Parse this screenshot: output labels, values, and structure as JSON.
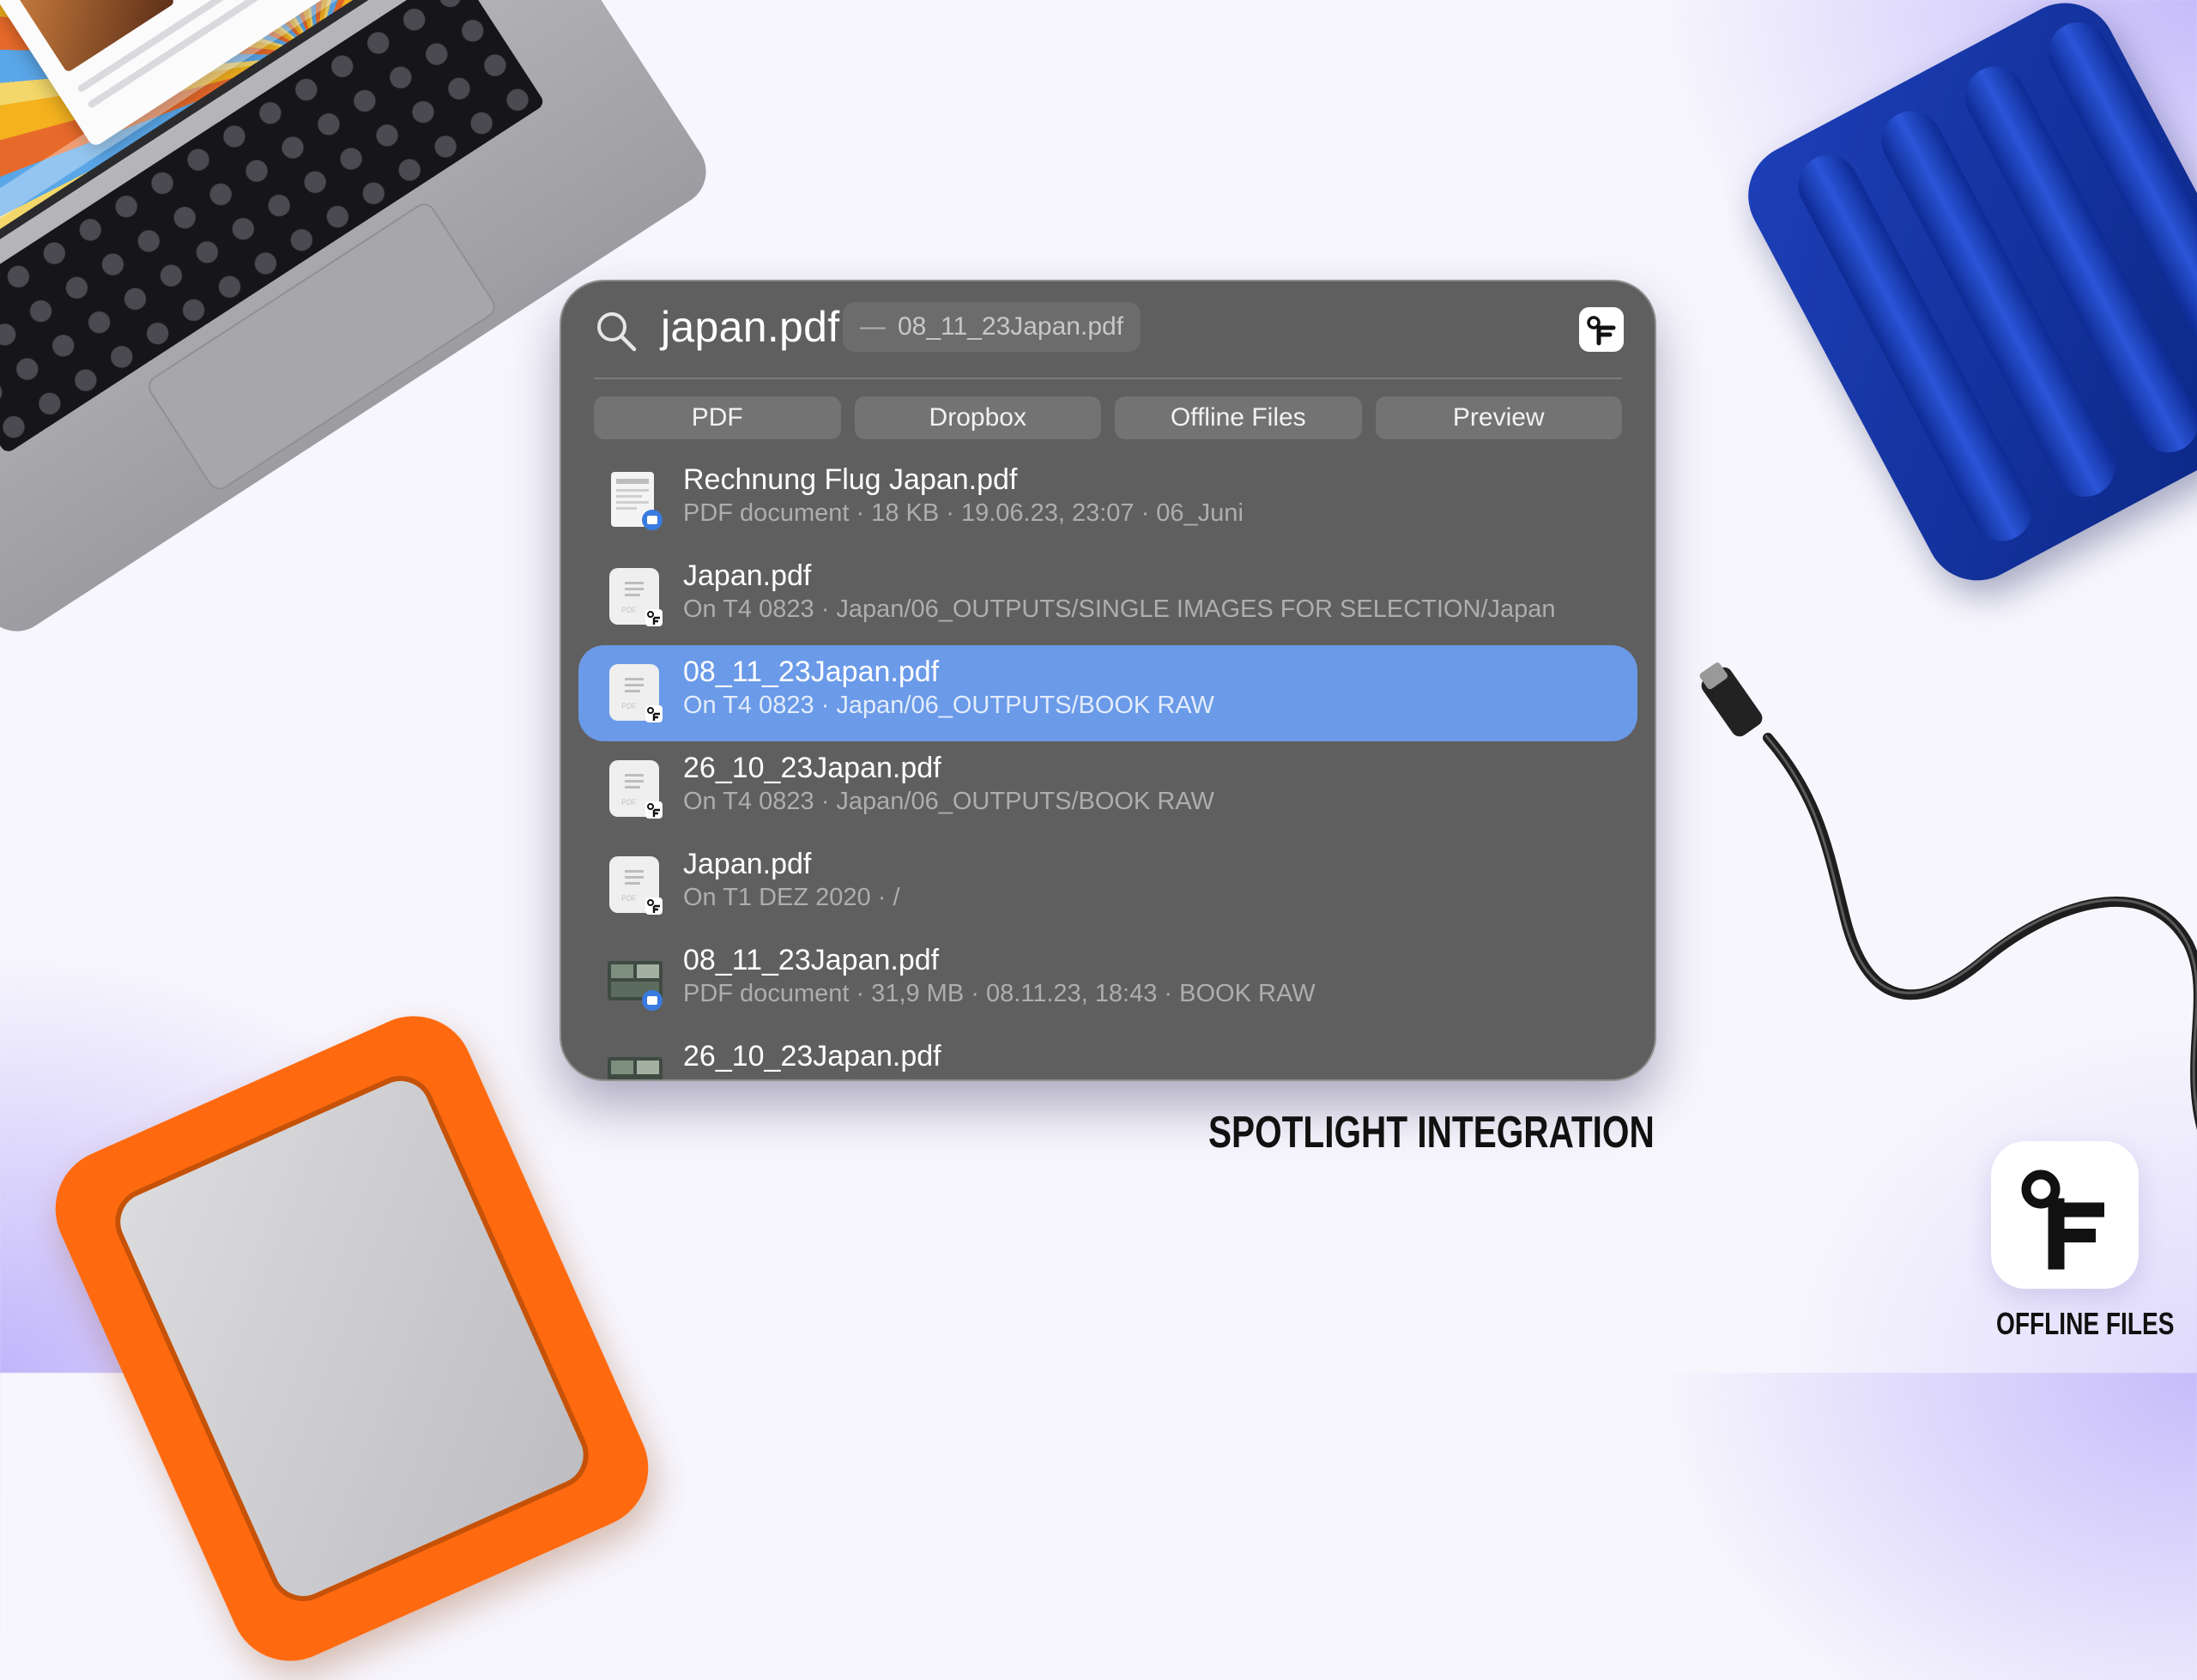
{
  "search": {
    "query": "japan.pdf",
    "suggestion": "08_11_23Japan.pdf"
  },
  "chips": [
    {
      "label": "PDF"
    },
    {
      "label": "Dropbox"
    },
    {
      "label": "Offline Files"
    },
    {
      "label": "Preview"
    }
  ],
  "results": [
    {
      "title": "Rechnung Flug Japan.pdf",
      "subtitle": "PDF document · 18 KB · 19.06.23, 23:07 · 06_Juni",
      "icon": "pdf-document-icon",
      "selected": false
    },
    {
      "title": "Japan.pdf",
      "subtitle": "On T4 0823 · Japan/06_OUTPUTS/SINGLE IMAGES FOR SELECTION/Japan",
      "icon": "offline-pdf-icon",
      "selected": false
    },
    {
      "title": "08_11_23Japan.pdf",
      "subtitle": "On T4 0823 · Japan/06_OUTPUTS/BOOK RAW",
      "icon": "offline-pdf-icon",
      "selected": true
    },
    {
      "title": "26_10_23Japan.pdf",
      "subtitle": "On T4 0823 · Japan/06_OUTPUTS/BOOK RAW",
      "icon": "offline-pdf-icon",
      "selected": false
    },
    {
      "title": "Japan.pdf",
      "subtitle": "On T1 DEZ 2020 · /",
      "icon": "offline-pdf-icon",
      "selected": false
    },
    {
      "title": "08_11_23Japan.pdf",
      "subtitle": "PDF document · 31,9 MB · 08.11.23, 18:43 · BOOK RAW",
      "icon": "pdf-thumbnail-icon",
      "selected": false
    },
    {
      "title": "26_10_23Japan.pdf",
      "subtitle": "",
      "icon": "pdf-thumbnail-icon",
      "selected": false
    }
  ],
  "captions": {
    "feature": "SPOTLIGHT INTEGRATION",
    "app_name": "OFFLINE FILES"
  },
  "colors": {
    "panel": "#5f5f5f",
    "selection": "#6a9ae8",
    "blue_drive": "#1d3fb8",
    "orange_drive": "#ff6a10"
  }
}
